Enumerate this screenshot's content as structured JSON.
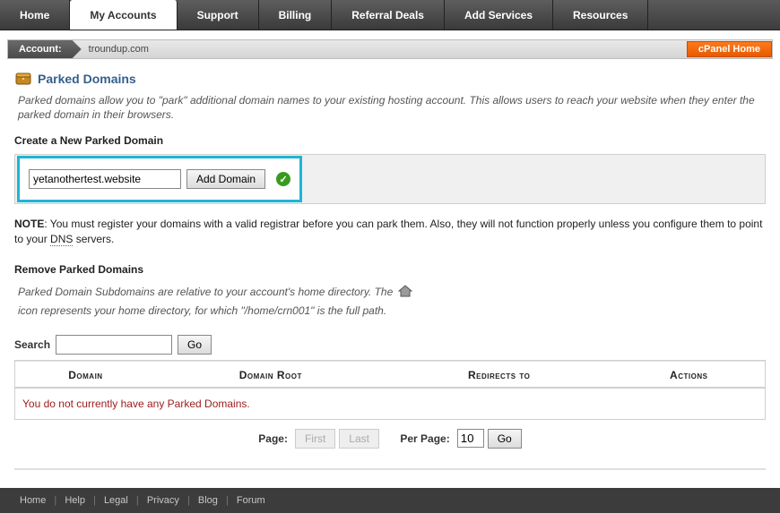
{
  "nav": {
    "tabs": [
      "Home",
      "My Accounts",
      "Support",
      "Billing",
      "Referral Deals",
      "Add Services",
      "Resources"
    ],
    "active_index": 1
  },
  "account_bar": {
    "label": "Account:",
    "domain": "troundup.com",
    "cpanel_button": "cPanel Home"
  },
  "page": {
    "title": "Parked Domains",
    "intro": "Parked domains allow you to \"park\" additional domain names to your existing hosting account. This allows users to reach your website when they enter the parked domain in their browsers."
  },
  "create": {
    "heading": "Create a New Parked Domain",
    "input_value": "yetanothertest.website",
    "button": "Add Domain",
    "status": "ok"
  },
  "note": {
    "prefix": "NOTE",
    "text_before": ": You must register your domains with a valid registrar before you can park them. Also, they will not function properly unless you configure them to point to your ",
    "dns": "DNS",
    "text_after": " servers."
  },
  "remove": {
    "heading": "Remove Parked Domains",
    "intro_before": "Parked Domain Subdomains are relative to your account's home directory. The",
    "intro_after_icon": "icon represents your home directory, for which \"/home/crn001\" is the full path."
  },
  "search": {
    "label": "Search",
    "value": "",
    "go": "Go"
  },
  "table": {
    "cols": [
      "Domain",
      "Domain Root",
      "Redirects to",
      "Actions"
    ],
    "empty": "You do not currently have any Parked Domains."
  },
  "paginator": {
    "page_label": "Page:",
    "first": "First",
    "last": "Last",
    "perpage_label": "Per Page:",
    "perpage_value": "10",
    "go": "Go"
  },
  "footer": {
    "links": [
      "Home",
      "Help",
      "Legal",
      "Privacy",
      "Blog",
      "Forum"
    ]
  }
}
